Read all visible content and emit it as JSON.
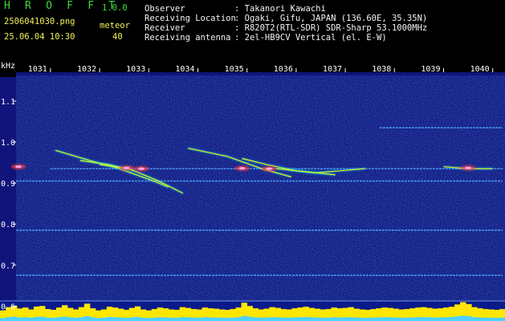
{
  "app": {
    "name": "H R O F F T",
    "version": "1.0.0",
    "filename": "2506041030.png",
    "mode_label": "meteor",
    "datetime": "25.06.04 10:30",
    "count": "40"
  },
  "station": {
    "observer_label": "Observer",
    "observer_value": ": Takanori Kawachi",
    "location_label": "Receiving Location",
    "location_value": ": Ogaki, Gifu, JAPAN (136.60E, 35.35N)",
    "receiver_label": "Receiver",
    "receiver_value": ": R820T2(RTL-SDR) SDR-Sharp 53.1000MHz",
    "antenna_label": "Receiving antenna",
    "antenna_value": ": 2el-HB9CV Vertical (el. E-W)"
  },
  "colors": {
    "background": "#10147a",
    "text_green": "#3ddc3d",
    "text_yellow": "#f2f05a",
    "trace_yellow": "#ffff00",
    "trace_cyan": "#00e5ff",
    "carrier_blue": "#4fa3ff"
  },
  "chart_data": {
    "type": "spectrogram",
    "y_unit": "kHz",
    "x_ticks": [
      {
        "label": "1031",
        "value": 1031
      },
      {
        "label": "1032",
        "value": 1032
      },
      {
        "label": "1033",
        "value": 1033
      },
      {
        "label": "1034",
        "value": 1034
      },
      {
        "label": "1035",
        "value": 1035
      },
      {
        "label": "1036",
        "value": 1036
      },
      {
        "label": "1037",
        "value": 1037
      },
      {
        "label": "1038",
        "value": 1038
      },
      {
        "label": "1039",
        "value": 1039
      },
      {
        "label": "1040",
        "value": 1040
      }
    ],
    "xlim": [
      1030.3,
      1040.25
    ],
    "ylim": [
      0.585,
      1.19
    ],
    "y_ticks": [
      {
        "label": "1.1",
        "value": 1.1
      },
      {
        "label": "1.0",
        "value": 1.0
      },
      {
        "label": "0.9",
        "value": 0.9
      },
      {
        "label": "0.8",
        "value": 0.8
      },
      {
        "label": "0.7",
        "value": 0.7
      },
      {
        "label": "0.6",
        "value": 0.6
      }
    ],
    "carriers": [
      {
        "freq": 0.935,
        "from": 1031.0,
        "to": 1040.2
      },
      {
        "freq": 0.905,
        "from": 1030.3,
        "to": 1040.2
      },
      {
        "freq": 0.785,
        "from": 1030.3,
        "to": 1040.2
      },
      {
        "freq": 0.675,
        "from": 1030.3,
        "to": 1040.2
      },
      {
        "freq": 1.035,
        "from": 1037.7,
        "to": 1040.2
      },
      {
        "freq": 0.605,
        "from": 1030.3,
        "to": 1040.2
      }
    ],
    "meteor_traces": [
      {
        "points": [
          [
            1031.1,
            0.98
          ],
          [
            1031.8,
            0.955
          ],
          [
            1032.4,
            0.935
          ],
          [
            1033.1,
            0.905
          ],
          [
            1033.4,
            0.89
          ]
        ]
      },
      {
        "points": [
          [
            1031.6,
            0.955
          ],
          [
            1032.2,
            0.945
          ],
          [
            1032.7,
            0.93
          ]
        ]
      },
      {
        "points": [
          [
            1032.0,
            0.945
          ],
          [
            1032.6,
            0.935
          ],
          [
            1033.2,
            0.905
          ],
          [
            1033.7,
            0.875
          ]
        ]
      },
      {
        "points": [
          [
            1033.8,
            0.985
          ],
          [
            1034.6,
            0.965
          ],
          [
            1035.3,
            0.935
          ],
          [
            1035.9,
            0.915
          ]
        ]
      },
      {
        "points": [
          [
            1034.9,
            0.96
          ],
          [
            1035.4,
            0.945
          ],
          [
            1036.0,
            0.93
          ],
          [
            1036.8,
            0.92
          ]
        ]
      },
      {
        "points": [
          [
            1035.6,
            0.935
          ],
          [
            1036.4,
            0.925
          ],
          [
            1037.4,
            0.935
          ]
        ]
      },
      {
        "points": [
          [
            1039.0,
            0.94
          ],
          [
            1039.5,
            0.935
          ],
          [
            1040.0,
            0.935
          ]
        ]
      }
    ],
    "hotspots": [
      {
        "x": 1032.55,
        "freq": 0.937
      },
      {
        "x": 1032.85,
        "freq": 0.935
      },
      {
        "x": 1034.9,
        "freq": 0.936
      },
      {
        "x": 1035.45,
        "freq": 0.935
      },
      {
        "x": 1039.5,
        "freq": 0.937
      },
      {
        "x": 1030.35,
        "freq": 0.94
      }
    ],
    "activity_levels": [
      0.55,
      0.72,
      0.8,
      0.65,
      0.7,
      0.6,
      0.75,
      0.78,
      0.62,
      0.58,
      0.7,
      0.82,
      0.68,
      0.6,
      0.72,
      0.9,
      0.66,
      0.55,
      0.6,
      0.74,
      0.7,
      0.64,
      0.58,
      0.68,
      0.76,
      0.6,
      0.55,
      0.62,
      0.7,
      0.66,
      0.6,
      0.58,
      0.72,
      0.68,
      0.62,
      0.6,
      0.7,
      0.66,
      0.64,
      0.6,
      0.58,
      0.62,
      0.7,
      0.95,
      0.78,
      0.66,
      0.6,
      0.64,
      0.72,
      0.68,
      0.62,
      0.6,
      0.66,
      0.7,
      0.74,
      0.68,
      0.64,
      0.6,
      0.62,
      0.7,
      0.66,
      0.68,
      0.72,
      0.64,
      0.6,
      0.58,
      0.62,
      0.66,
      0.7,
      0.68,
      0.64,
      0.6,
      0.62,
      0.66,
      0.7,
      0.72,
      0.68,
      0.64,
      0.66,
      0.7,
      0.74,
      0.86,
      0.98,
      0.88,
      0.72,
      0.66,
      0.62,
      0.6,
      0.58,
      0.62
    ]
  }
}
